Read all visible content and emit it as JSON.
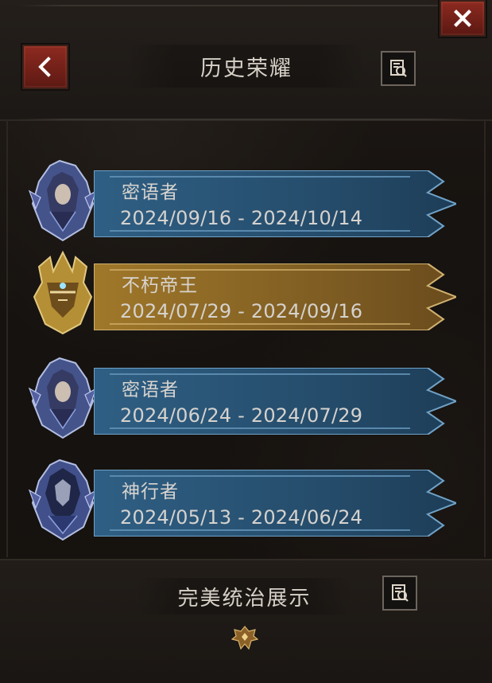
{
  "header": {
    "title": "历史荣耀"
  },
  "honors": [
    {
      "name": "密语者",
      "date_range": "2024/09/16 - 2024/10/14",
      "theme": "blue",
      "emblem": "hooded-female-icon"
    },
    {
      "name": "不朽帝王",
      "date_range": "2024/07/29 - 2024/09/16",
      "theme": "gold",
      "emblem": "crowned-helm-icon"
    },
    {
      "name": "密语者",
      "date_range": "2024/06/24 - 2024/07/29",
      "theme": "blue",
      "emblem": "hooded-female-icon"
    },
    {
      "name": "神行者",
      "date_range": "2024/05/13 - 2024/06/24",
      "theme": "blue",
      "emblem": "hooded-mask-icon"
    }
  ],
  "footer": {
    "title": "完美统治展示"
  },
  "colors": {
    "accent_red": "#8d2a20",
    "blue_banner": "#2f5f84",
    "gold_banner": "#a0782a",
    "text_light": "#d8d4cf"
  }
}
